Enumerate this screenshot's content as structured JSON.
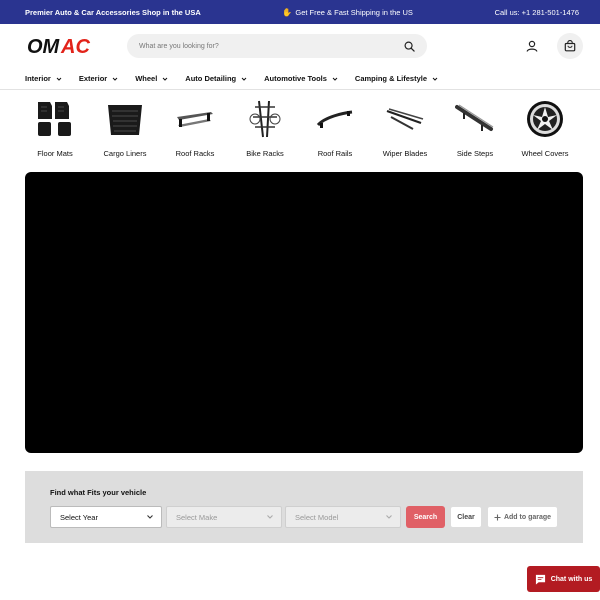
{
  "announcement": {
    "left": "Premier Auto & Car Accessories Shop in the USA",
    "center_icon": "raised-hand-emoji",
    "center": "Get Free & Fast Shipping in the US",
    "right": "Call us: +1 281-501-1476"
  },
  "header": {
    "logo_text": "OMAC",
    "search_placeholder": "What are you looking for?",
    "icons": [
      "search-icon",
      "account-icon",
      "cart-icon"
    ]
  },
  "nav": {
    "items": [
      {
        "label": "Interior"
      },
      {
        "label": "Exterior"
      },
      {
        "label": "Wheel"
      },
      {
        "label": "Auto Detailing"
      },
      {
        "label": "Automotive Tools"
      },
      {
        "label": "Camping & Lifestyle"
      }
    ]
  },
  "categories": [
    {
      "label": "Floor Mats",
      "icon": "floor-mats-icon"
    },
    {
      "label": "Cargo Liners",
      "icon": "cargo-liner-icon"
    },
    {
      "label": "Roof Racks",
      "icon": "roof-rack-icon"
    },
    {
      "label": "Bike Racks",
      "icon": "bike-rack-icon"
    },
    {
      "label": "Roof Rails",
      "icon": "roof-rail-icon"
    },
    {
      "label": "Wiper Blades",
      "icon": "wiper-blade-icon"
    },
    {
      "label": "Side Steps",
      "icon": "side-step-icon"
    },
    {
      "label": "Wheel Covers",
      "icon": "wheel-cover-icon"
    }
  ],
  "finder": {
    "title": "Find what Fits your vehicle",
    "year": "Select Year",
    "make": "Select Make",
    "model": "Select Model",
    "search_label": "Search",
    "clear_label": "Clear",
    "garage_label": "Add to garage"
  },
  "chat": {
    "label": "Chat with us"
  },
  "colors": {
    "announcement_bg": "#2a3490",
    "logo_red": "#e2231a",
    "search_button": "#e06066",
    "chat_button": "#b31b22"
  }
}
